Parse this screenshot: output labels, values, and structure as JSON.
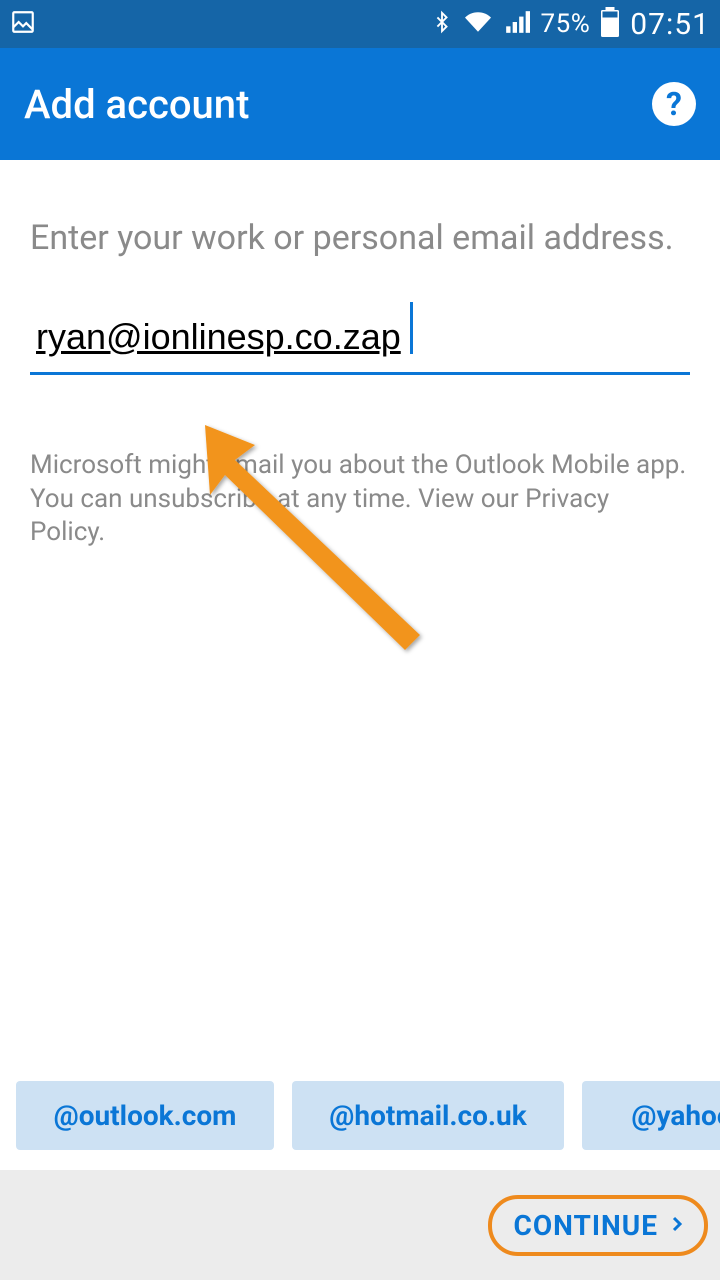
{
  "statusbar": {
    "battery_pct": "75%",
    "time": "07:51"
  },
  "appbar": {
    "title": "Add account"
  },
  "instruction_text": "Enter your work or personal email address.",
  "email_value": "ryan@ionlinesp.co.zap",
  "disclaimer_text": "Microsoft might email you about the Outlook Mobile app. You can unsubscribe at any time. View our Privacy Policy.",
  "suggestions": {
    "items": [
      "@outlook.com",
      "@hotmail.co.uk",
      "@yahoo"
    ]
  },
  "continue_label": "CONTINUE"
}
